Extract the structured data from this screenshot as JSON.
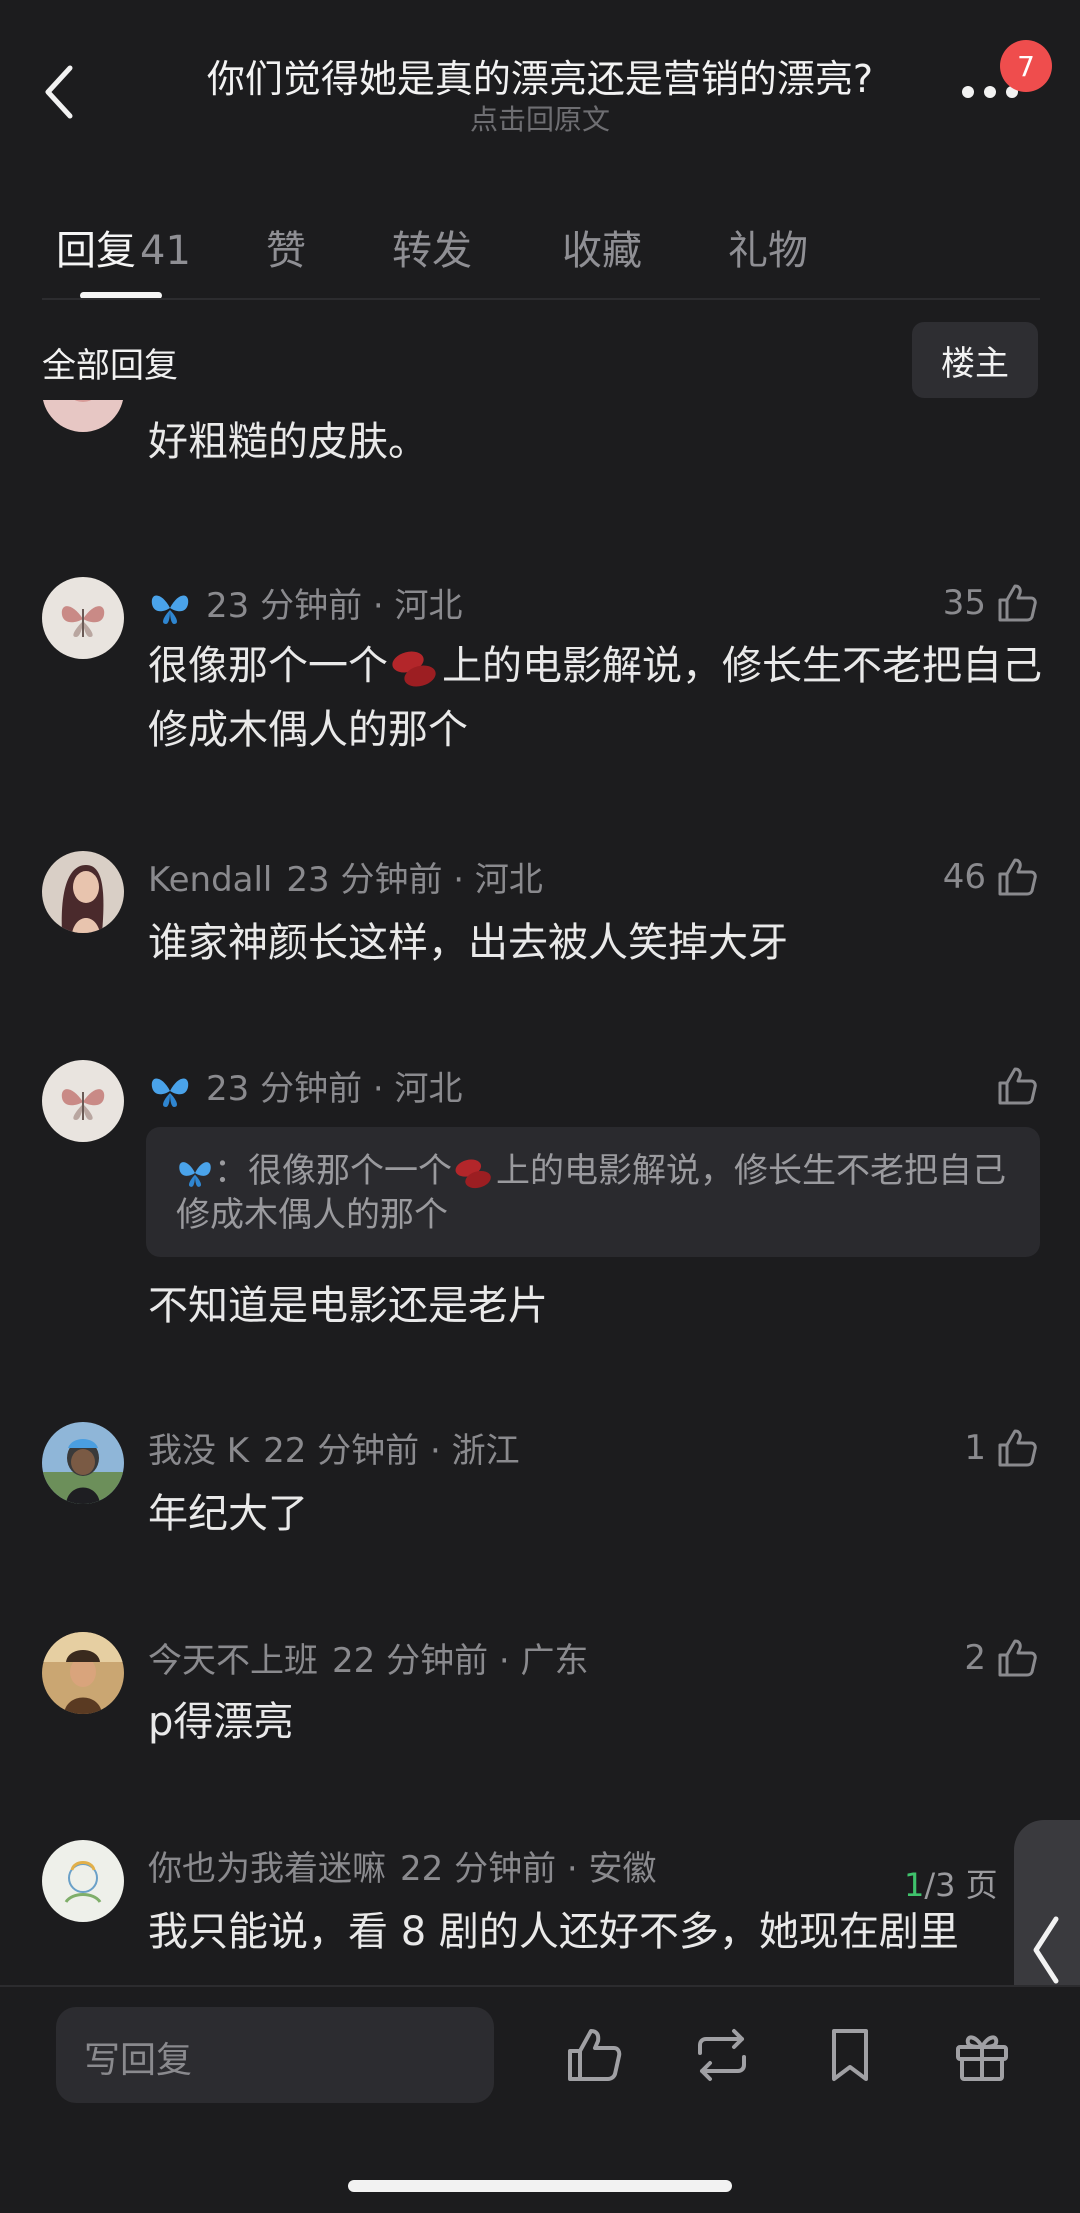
{
  "header": {
    "title": "你们觉得她是真的漂亮还是营销的漂亮?",
    "subtitle": "点击回原文",
    "notification_count": "7"
  },
  "tabs": [
    {
      "label": "回复",
      "count": "41"
    },
    {
      "label": "赞"
    },
    {
      "label": "转发"
    },
    {
      "label": "收藏"
    },
    {
      "label": "礼物"
    }
  ],
  "filter": {
    "label": "全部回复",
    "op_button": "楼主"
  },
  "comments": [
    {
      "text": "好粗糙的皮肤。"
    },
    {
      "name": "",
      "time": "23 分钟前 · 河北",
      "likes": "35",
      "text_before": "很像那个一个",
      "text_after": "上的电影解说，修长生不老把自己修成木偶人的那个"
    },
    {
      "name": "Kendall",
      "time": "23 分钟前 · 河北",
      "likes": "46",
      "text": "谁家神颜长这样，出去被人笑掉大牙"
    },
    {
      "name": "",
      "time": "23 分钟前 · 河北",
      "likes": "",
      "quote_before": "：很像那个一个",
      "quote_after": "上的电影解说，修长生不老把自己修成木偶人的那个",
      "text": "不知道是电影还是老片"
    },
    {
      "name": "我没 K",
      "time": "22 分钟前 · 浙江",
      "likes": "1",
      "text": "年纪大了"
    },
    {
      "name": "今天不上班",
      "time": "22 分钟前 · 广东",
      "likes": "2",
      "text": "p得漂亮"
    },
    {
      "name": "你也为我着迷嘛",
      "time": "22 分钟前 · 安徽",
      "text": "我只能说，看 8 剧的人还好不多，她现在剧里"
    }
  ],
  "pager": {
    "current": "1",
    "total": "/3 页"
  },
  "bottom_bar": {
    "reply_placeholder": "写回复"
  },
  "colors": {
    "background": "#1c1c1e",
    "badge": "#ef4d4d",
    "pager_current": "#3fc26c"
  }
}
